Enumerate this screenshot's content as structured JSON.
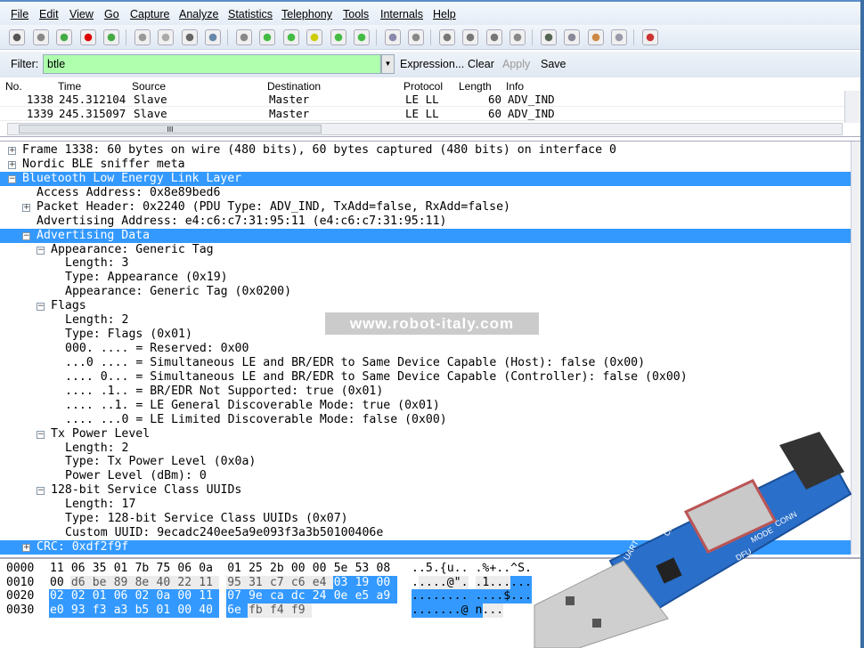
{
  "menu": [
    "File",
    "Edit",
    "View",
    "Go",
    "Capture",
    "Analyze",
    "Statistics",
    "Telephony",
    "Tools",
    "Internals",
    "Help"
  ],
  "toolbar": [
    "start-capture-icon",
    "capture-options-icon",
    "shark-fin-icon",
    "stop-capture-icon",
    "restart-capture-icon",
    "open-file-icon",
    "save-file-icon",
    "close-file-icon",
    "reload-icon",
    "find-icon",
    "go-back-icon",
    "go-forward-icon",
    "go-to-packet-icon",
    "first-packet-icon",
    "last-packet-icon",
    "colorize-icon",
    "autoscroll-icon",
    "zoom-in-icon",
    "zoom-out-icon",
    "normal-size-icon",
    "resize-columns-icon",
    "capture-filters-icon",
    "display-filters-icon",
    "coloring-rules-icon",
    "preferences-icon",
    "help-icon"
  ],
  "filter": {
    "label": "Filter:",
    "value": "btle",
    "expression": "Expression...",
    "clear": "Clear",
    "apply": "Apply",
    "save": "Save",
    "bg": "#afffaf"
  },
  "packet_list": {
    "columns": [
      "No.",
      "Time",
      "Source",
      "Destination",
      "Protocol",
      "Length",
      "Info"
    ],
    "rows": [
      {
        "no": "1338",
        "time": "245.312104",
        "source": "Slave",
        "destination": "Master",
        "protocol": "LE LL",
        "length": "60",
        "info": "ADV_IND"
      },
      {
        "no": "1339",
        "time": "245.315097",
        "source": "Slave",
        "destination": "Master",
        "protocol": "LE LL",
        "length": "60",
        "info": "ADV_IND"
      }
    ],
    "scroll_thumb": "III"
  },
  "tree": [
    {
      "l": 0,
      "e": "+",
      "t": "Frame 1338: 60 bytes on wire (480 bits), 60 bytes captured (480 bits) on interface 0"
    },
    {
      "l": 0,
      "e": "+",
      "t": "Nordic BLE sniffer meta"
    },
    {
      "l": 0,
      "e": "-",
      "t": "Bluetooth Low Energy Link Layer",
      "s": true
    },
    {
      "l": 1,
      "e": "",
      "t": "Access Address: 0x8e89bed6"
    },
    {
      "l": 1,
      "e": "+",
      "t": "Packet Header: 0x2240 (PDU Type: ADV_IND, TxAdd=false, RxAdd=false)"
    },
    {
      "l": 1,
      "e": "",
      "t": "Advertising Address: e4:c6:c7:31:95:11 (e4:c6:c7:31:95:11)"
    },
    {
      "l": 1,
      "e": "-",
      "t": "Advertising Data",
      "s": true
    },
    {
      "l": 2,
      "e": "-",
      "t": "Appearance: Generic Tag"
    },
    {
      "l": 3,
      "e": "",
      "t": "Length: 3"
    },
    {
      "l": 3,
      "e": "",
      "t": "Type: Appearance (0x19)"
    },
    {
      "l": 3,
      "e": "",
      "t": "Appearance: Generic Tag (0x0200)"
    },
    {
      "l": 2,
      "e": "-",
      "t": "Flags"
    },
    {
      "l": 3,
      "e": "",
      "t": "Length: 2"
    },
    {
      "l": 3,
      "e": "",
      "t": "Type: Flags (0x01)"
    },
    {
      "l": 3,
      "e": "",
      "t": "000. .... = Reserved: 0x00"
    },
    {
      "l": 3,
      "e": "",
      "t": "...0 .... = Simultaneous LE and BR/EDR to Same Device Capable (Host): false (0x00)"
    },
    {
      "l": 3,
      "e": "",
      "t": ".... 0... = Simultaneous LE and BR/EDR to Same Device Capable (Controller): false (0x00)"
    },
    {
      "l": 3,
      "e": "",
      "t": ".... .1.. = BR/EDR Not Supported: true (0x01)"
    },
    {
      "l": 3,
      "e": "",
      "t": ".... ..1. = LE General Discoverable Mode: true (0x01)"
    },
    {
      "l": 3,
      "e": "",
      "t": ".... ...0 = LE Limited Discoverable Mode: false (0x00)"
    },
    {
      "l": 2,
      "e": "-",
      "t": "Tx Power Level"
    },
    {
      "l": 3,
      "e": "",
      "t": "Length: 2"
    },
    {
      "l": 3,
      "e": "",
      "t": "Type: Tx Power Level (0x0a)"
    },
    {
      "l": 3,
      "e": "",
      "t": "Power Level (dBm): 0"
    },
    {
      "l": 2,
      "e": "-",
      "t": "128-bit Service Class UUIDs"
    },
    {
      "l": 3,
      "e": "",
      "t": "Length: 17"
    },
    {
      "l": 3,
      "e": "",
      "t": "Type: 128-bit Service Class UUIDs (0x07)"
    },
    {
      "l": 3,
      "e": "",
      "t": "Custom UUID: 9ecadc240ee5a9e093f3a3b50100406e"
    },
    {
      "l": 1,
      "e": "+",
      "t": "CRC: 0xdf2f9f",
      "s": true
    }
  ],
  "hex": {
    "lines": [
      {
        "offset": "0000",
        "bytes": "11 06 35 01 7b 75 06 0a 01 25 2b 00 00 5e 53 08",
        "ascii": "..5.{u.. .%+..^S."
      },
      {
        "offset": "0010",
        "bytes": "00 d6 be 89 8e 40 22 11 95 31 c7 c6 e4 03 19 00",
        "ascii": ".....@\". .1......"
      },
      {
        "offset": "0020",
        "bytes": "02 02 01 06 02 0a 00 11 07 9e ca dc 24 0e e5 a9",
        "ascii": "........ ....$..."
      },
      {
        "offset": "0030",
        "bytes": "e0 93 f3 a3 b5 01 00 40 6e fb f4 f9",
        "ascii": ".......@ n..."
      }
    ],
    "selected_bytes": [
      29,
      56
    ],
    "field_bytes": [
      [
        17,
        28
      ],
      [
        57,
        59
      ]
    ]
  },
  "watermark": "www.robot-italy.com",
  "photo": {
    "labels": [
      "UART",
      "CMD",
      "DFU",
      "MODE",
      "CONN"
    ],
    "pcb_color": "#2a6fc9"
  }
}
